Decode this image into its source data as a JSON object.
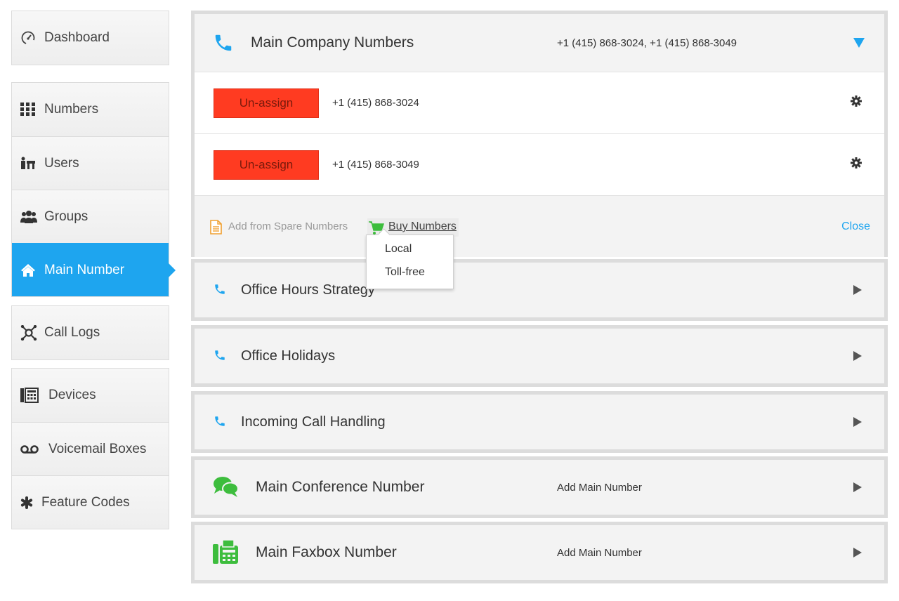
{
  "sidebar": {
    "items": [
      {
        "label": "Dashboard",
        "icon": "speedometer-icon"
      },
      {
        "label": "Numbers",
        "icon": "keypad-icon"
      },
      {
        "label": "Users",
        "icon": "users-icon"
      },
      {
        "label": "Groups",
        "icon": "groups-icon"
      },
      {
        "label": "Main Number",
        "icon": "home-icon",
        "active": true
      },
      {
        "label": "Call Logs",
        "icon": "call-logs-icon"
      },
      {
        "label": "Devices",
        "icon": "desk-phone-icon"
      },
      {
        "label": "Voicemail Boxes",
        "icon": "voicemail-icon"
      },
      {
        "label": "Feature Codes",
        "icon": "asterisk-icon"
      }
    ]
  },
  "main_company": {
    "title": "Main Company Numbers",
    "summary": "+1 (415) 868-3024, +1 (415) 868-3049",
    "rows": [
      {
        "button": "Un-assign",
        "number": "+1 (415) 868-3024"
      },
      {
        "button": "Un-assign",
        "number": "+1 (415) 868-3049"
      }
    ],
    "add_spare": "Add from Spare Numbers",
    "buy_numbers": "Buy Numbers",
    "close": "Close",
    "buy_menu": [
      "Local",
      "Toll-free"
    ]
  },
  "panels": [
    {
      "title": "Office Hours Strategy",
      "icon": "phone-icon"
    },
    {
      "title": "Office Holidays",
      "icon": "phone-icon"
    },
    {
      "title": "Incoming Call Handling",
      "icon": "phone-icon"
    },
    {
      "title": "Main Conference Number",
      "icon": "chat-bubbles-icon",
      "action": "Add Main Number"
    },
    {
      "title": "Main Faxbox Number",
      "icon": "fax-icon",
      "action": "Add Main Number"
    }
  ],
  "colors": {
    "accent": "#1ea5ef",
    "danger": "#ff3b21",
    "success": "#3dbd3d",
    "warning": "#f0a030"
  }
}
